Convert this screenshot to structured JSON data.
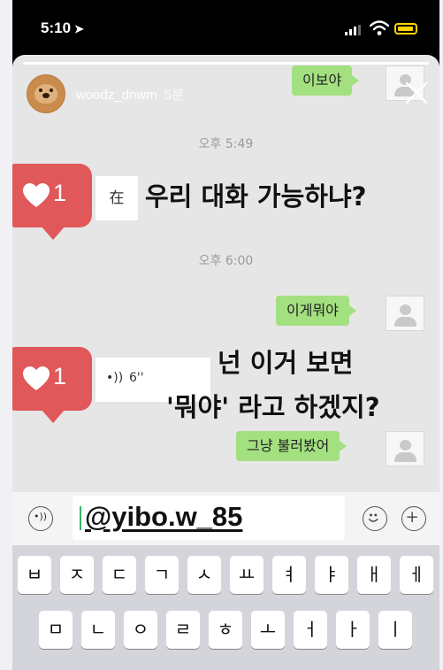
{
  "status_bar": {
    "time": "5:10",
    "location_arrow": "➤",
    "battery_color": "#ffd400"
  },
  "story": {
    "username": "woodz_dnwm",
    "time_ago": "5분",
    "progress": 1.0
  },
  "chat": {
    "messages": [
      {
        "type": "sent",
        "text": "이보야"
      },
      {
        "type": "timestamp",
        "text": "오후 5:49"
      },
      {
        "type": "received",
        "text": "在",
        "likes": "1"
      },
      {
        "type": "caption",
        "text": "우리 대화 가능하냐?"
      },
      {
        "type": "timestamp",
        "text": "오후 6:00"
      },
      {
        "type": "sent",
        "text": "이게뭐야"
      },
      {
        "type": "received_voice",
        "text": "6''",
        "likes": "1"
      },
      {
        "type": "caption",
        "text": "넌 이거 보면"
      },
      {
        "type": "caption",
        "text": "'뭐야' 라고 하겠지?"
      },
      {
        "type": "sent",
        "text": "그냥 불러봤어"
      }
    ]
  },
  "input": {
    "value": "@yibo.w_85"
  },
  "keyboard": {
    "row1": [
      "ㅂ",
      "ㅈ",
      "ㄷ",
      "ㄱ",
      "ㅅ",
      "ㅛ",
      "ㅕ",
      "ㅑ",
      "ㅐ",
      "ㅔ"
    ],
    "row2": [
      "ㅁ",
      "ㄴ",
      "ㅇ",
      "ㄹ",
      "ㅎ",
      "ㅗ",
      "ㅓ",
      "ㅏ",
      "ㅣ"
    ]
  },
  "colors": {
    "bubble_green": "#a3e080",
    "heart_red": "#e0585a",
    "cursor_green": "#3ab36a"
  },
  "icons": [
    "location-arrow-icon",
    "signal-icon",
    "wifi-icon",
    "battery-icon",
    "close-icon",
    "heart-icon",
    "voice-wave-icon",
    "voice-circle-icon",
    "emoji-icon",
    "plus-circle-icon",
    "profile-placeholder-icon"
  ]
}
